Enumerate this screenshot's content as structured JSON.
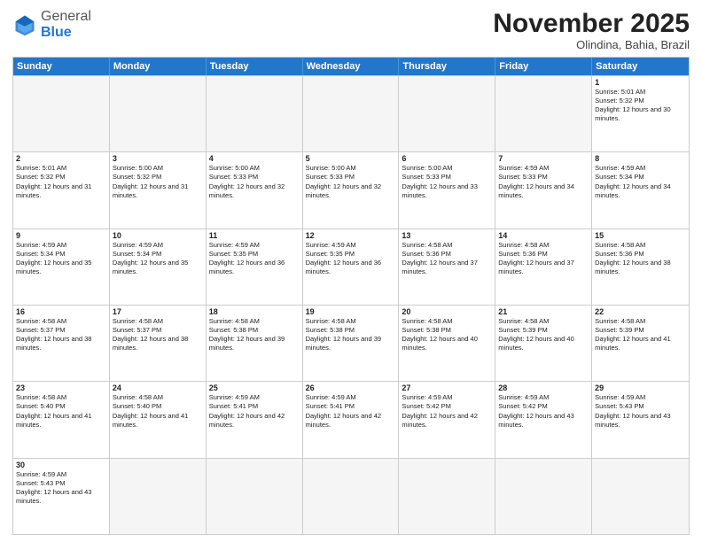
{
  "header": {
    "logo_general": "General",
    "logo_blue": "Blue",
    "month_title": "November 2025",
    "location": "Olindina, Bahia, Brazil"
  },
  "weekdays": [
    "Sunday",
    "Monday",
    "Tuesday",
    "Wednesday",
    "Thursday",
    "Friday",
    "Saturday"
  ],
  "rows": [
    [
      {
        "day": "",
        "info": "",
        "empty": true
      },
      {
        "day": "",
        "info": "",
        "empty": true
      },
      {
        "day": "",
        "info": "",
        "empty": true
      },
      {
        "day": "",
        "info": "",
        "empty": true
      },
      {
        "day": "",
        "info": "",
        "empty": true
      },
      {
        "day": "",
        "info": "",
        "empty": true
      },
      {
        "day": "1",
        "info": "Sunrise: 5:01 AM\nSunset: 5:32 PM\nDaylight: 12 hours and 30 minutes.",
        "empty": false
      }
    ],
    [
      {
        "day": "2",
        "info": "Sunrise: 5:01 AM\nSunset: 5:32 PM\nDaylight: 12 hours and 31 minutes.",
        "empty": false
      },
      {
        "day": "3",
        "info": "Sunrise: 5:00 AM\nSunset: 5:32 PM\nDaylight: 12 hours and 31 minutes.",
        "empty": false
      },
      {
        "day": "4",
        "info": "Sunrise: 5:00 AM\nSunset: 5:33 PM\nDaylight: 12 hours and 32 minutes.",
        "empty": false
      },
      {
        "day": "5",
        "info": "Sunrise: 5:00 AM\nSunset: 5:33 PM\nDaylight: 12 hours and 32 minutes.",
        "empty": false
      },
      {
        "day": "6",
        "info": "Sunrise: 5:00 AM\nSunset: 5:33 PM\nDaylight: 12 hours and 33 minutes.",
        "empty": false
      },
      {
        "day": "7",
        "info": "Sunrise: 4:59 AM\nSunset: 5:33 PM\nDaylight: 12 hours and 34 minutes.",
        "empty": false
      },
      {
        "day": "8",
        "info": "Sunrise: 4:59 AM\nSunset: 5:34 PM\nDaylight: 12 hours and 34 minutes.",
        "empty": false
      }
    ],
    [
      {
        "day": "9",
        "info": "Sunrise: 4:59 AM\nSunset: 5:34 PM\nDaylight: 12 hours and 35 minutes.",
        "empty": false
      },
      {
        "day": "10",
        "info": "Sunrise: 4:59 AM\nSunset: 5:34 PM\nDaylight: 12 hours and 35 minutes.",
        "empty": false
      },
      {
        "day": "11",
        "info": "Sunrise: 4:59 AM\nSunset: 5:35 PM\nDaylight: 12 hours and 36 minutes.",
        "empty": false
      },
      {
        "day": "12",
        "info": "Sunrise: 4:59 AM\nSunset: 5:35 PM\nDaylight: 12 hours and 36 minutes.",
        "empty": false
      },
      {
        "day": "13",
        "info": "Sunrise: 4:58 AM\nSunset: 5:36 PM\nDaylight: 12 hours and 37 minutes.",
        "empty": false
      },
      {
        "day": "14",
        "info": "Sunrise: 4:58 AM\nSunset: 5:36 PM\nDaylight: 12 hours and 37 minutes.",
        "empty": false
      },
      {
        "day": "15",
        "info": "Sunrise: 4:58 AM\nSunset: 5:36 PM\nDaylight: 12 hours and 38 minutes.",
        "empty": false
      }
    ],
    [
      {
        "day": "16",
        "info": "Sunrise: 4:58 AM\nSunset: 5:37 PM\nDaylight: 12 hours and 38 minutes.",
        "empty": false
      },
      {
        "day": "17",
        "info": "Sunrise: 4:58 AM\nSunset: 5:37 PM\nDaylight: 12 hours and 38 minutes.",
        "empty": false
      },
      {
        "day": "18",
        "info": "Sunrise: 4:58 AM\nSunset: 5:38 PM\nDaylight: 12 hours and 39 minutes.",
        "empty": false
      },
      {
        "day": "19",
        "info": "Sunrise: 4:58 AM\nSunset: 5:38 PM\nDaylight: 12 hours and 39 minutes.",
        "empty": false
      },
      {
        "day": "20",
        "info": "Sunrise: 4:58 AM\nSunset: 5:38 PM\nDaylight: 12 hours and 40 minutes.",
        "empty": false
      },
      {
        "day": "21",
        "info": "Sunrise: 4:58 AM\nSunset: 5:39 PM\nDaylight: 12 hours and 40 minutes.",
        "empty": false
      },
      {
        "day": "22",
        "info": "Sunrise: 4:58 AM\nSunset: 5:39 PM\nDaylight: 12 hours and 41 minutes.",
        "empty": false
      }
    ],
    [
      {
        "day": "23",
        "info": "Sunrise: 4:58 AM\nSunset: 5:40 PM\nDaylight: 12 hours and 41 minutes.",
        "empty": false
      },
      {
        "day": "24",
        "info": "Sunrise: 4:58 AM\nSunset: 5:40 PM\nDaylight: 12 hours and 41 minutes.",
        "empty": false
      },
      {
        "day": "25",
        "info": "Sunrise: 4:59 AM\nSunset: 5:41 PM\nDaylight: 12 hours and 42 minutes.",
        "empty": false
      },
      {
        "day": "26",
        "info": "Sunrise: 4:59 AM\nSunset: 5:41 PM\nDaylight: 12 hours and 42 minutes.",
        "empty": false
      },
      {
        "day": "27",
        "info": "Sunrise: 4:59 AM\nSunset: 5:42 PM\nDaylight: 12 hours and 42 minutes.",
        "empty": false
      },
      {
        "day": "28",
        "info": "Sunrise: 4:59 AM\nSunset: 5:42 PM\nDaylight: 12 hours and 43 minutes.",
        "empty": false
      },
      {
        "day": "29",
        "info": "Sunrise: 4:59 AM\nSunset: 5:43 PM\nDaylight: 12 hours and 43 minutes.",
        "empty": false
      }
    ],
    [
      {
        "day": "30",
        "info": "Sunrise: 4:59 AM\nSunset: 5:43 PM\nDaylight: 12 hours and 43 minutes.",
        "empty": false
      },
      {
        "day": "",
        "info": "",
        "empty": true
      },
      {
        "day": "",
        "info": "",
        "empty": true
      },
      {
        "day": "",
        "info": "",
        "empty": true
      },
      {
        "day": "",
        "info": "",
        "empty": true
      },
      {
        "day": "",
        "info": "",
        "empty": true
      },
      {
        "day": "",
        "info": "",
        "empty": true
      }
    ]
  ]
}
